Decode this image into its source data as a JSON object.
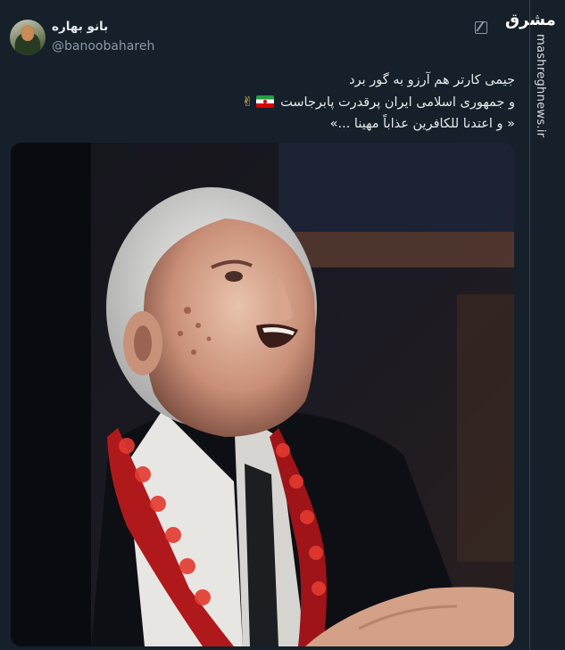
{
  "author": {
    "display_name": "بانو بهاره",
    "handle": "@banoobahareh"
  },
  "tweet": {
    "line1": "جیمی کارتر هم آرزو به گور برد",
    "line2": "و جمهوری اسلامی ایران پرقدرت پابرجاست",
    "line3": "« و اعتدنا للکافرین عذاباً مهینا ...»"
  },
  "watermark": {
    "logo": "مشرق",
    "site": "mashreghnews.ir"
  },
  "icons": {
    "edit": "edit-icon",
    "flag": "iran-flag-emoji",
    "victory": "victory-hand-emoji"
  },
  "colors": {
    "background": "#15202b",
    "text": "#e7e9ea",
    "secondary_text": "#8b98a5"
  }
}
